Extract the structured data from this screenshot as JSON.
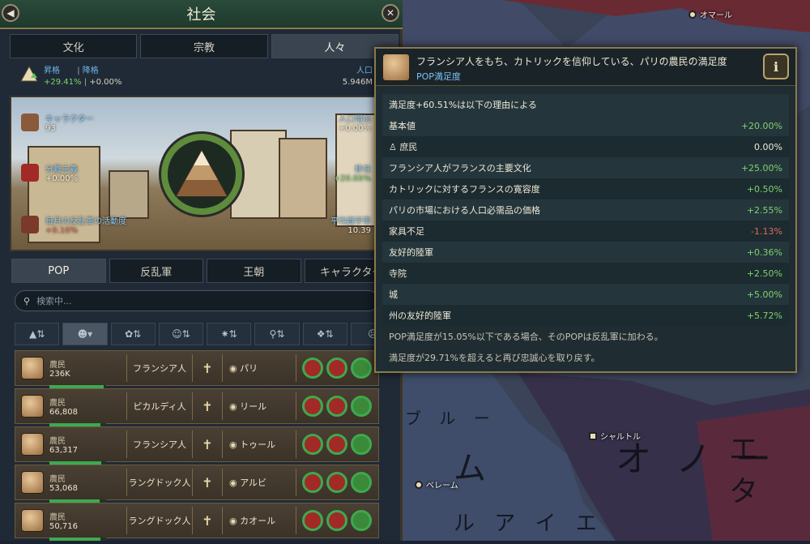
{
  "panel": {
    "title": "社会",
    "tabs": [
      "文化",
      "宗教",
      "人々"
    ],
    "active_tab": 2,
    "ascension_label": "昇格",
    "demotion_label": "降格",
    "ascension_value": "+29.41%",
    "demotion_value": "+0.00%",
    "population_label": "人口",
    "population_value": "5.946M"
  },
  "scene": {
    "character_label": "キャラクター",
    "character_value": "93",
    "separatism_label": "分離主義",
    "separatism_value": "+0.00%",
    "rebel_label": "毎月の反乱軍の活動度",
    "rebel_value": "+0.10%",
    "growth_label": "人口増加",
    "growth_value": "+0.00%",
    "migration_label": "移住",
    "migration_value": "+20.00%",
    "literacy_label": "平均識字率",
    "literacy_value": "10.39"
  },
  "subtabs": [
    "POP",
    "反乱軍",
    "王朝",
    "キャラクター"
  ],
  "active_subtab": 0,
  "search": {
    "placeholder": "検索中..."
  },
  "rows": [
    {
      "job": "農民",
      "count": "236K",
      "culture": "フランシア人",
      "religion": "✝",
      "location": "パリ",
      "progress": 0.95
    },
    {
      "job": "農民",
      "count": "66,808",
      "culture": "ピカルディ人",
      "religion": "✝",
      "location": "リール",
      "progress": 0.9
    },
    {
      "job": "農民",
      "count": "63,317",
      "culture": "フランシア人",
      "religion": "✝",
      "location": "トゥール",
      "progress": 0.92
    },
    {
      "job": "農民",
      "count": "53,068",
      "culture": "ラングドック人",
      "religion": "✝",
      "location": "アルビ",
      "progress": 0.88
    },
    {
      "job": "農民",
      "count": "50,716",
      "culture": "ラングドック人",
      "religion": "✝",
      "location": "カオール",
      "progress": 0.9
    }
  ],
  "tooltip": {
    "title": "フランシア人をもち、カトリックを信仰している、パリの農民の満足度",
    "subtitle": "POP満足度",
    "intro": "満足度+60.51%は以下の理由による",
    "lines": [
      {
        "label": "基本値",
        "value": "+20.00%",
        "tone": "green"
      },
      {
        "label": "♙ 庶民",
        "value": "0.00%",
        "tone": "white"
      },
      {
        "label": "フランシア人がフランスの主要文化",
        "value": "+25.00%",
        "tone": "green"
      },
      {
        "label": "カトリックに対するフランスの寛容度",
        "value": "+0.50%",
        "tone": "green"
      },
      {
        "label": "パリの市場における人口必需品の価格",
        "value": "+2.55%",
        "tone": "green"
      },
      {
        "label": "家具不足",
        "value": "-1.13%",
        "tone": "red"
      },
      {
        "label": "友好的陸軍",
        "value": "+0.36%",
        "tone": "green"
      },
      {
        "label": "寺院",
        "value": "+2.50%",
        "tone": "green"
      },
      {
        "label": "城",
        "value": "+5.00%",
        "tone": "green"
      },
      {
        "label": "州の友好的陸軍",
        "value": "+5.72%",
        "tone": "green"
      }
    ],
    "note1": "POP満足度が15.05%以下である場合、そのPOPは反乱軍に加わる。",
    "note2": "満足度が29.71%を超えると再び忠誠心を取り戻す。"
  },
  "map": {
    "labels": [
      "オマール",
      "シャルトル",
      "ベレーム"
    ],
    "regions": [
      "ム",
      "オ ノ ー",
      "エ タ",
      "ブ ル ー",
      "ル ア イ エ"
    ]
  }
}
